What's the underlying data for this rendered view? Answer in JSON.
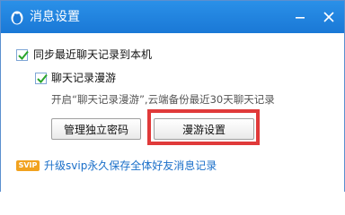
{
  "window": {
    "title": "消息设置"
  },
  "options": {
    "sync_recent_label": "同步最近聊天记录到本机",
    "roaming_label": "聊天记录漫游",
    "roaming_desc": "开启“聊天记录漫游”,云端备份最近30天聊天记录"
  },
  "buttons": {
    "manage_password": "管理独立密码",
    "roaming_settings": "漫游设置"
  },
  "footer": {
    "badge": "SVIP",
    "upgrade_text": "升级svip永久保存全体好友消息记录"
  },
  "colors": {
    "titlebar": "#1a78d6",
    "highlight": "#e03a3a",
    "link": "#1a6fc9",
    "badge": "#f1a21f"
  },
  "checkboxes": {
    "sync_recent": true,
    "roaming": true
  }
}
